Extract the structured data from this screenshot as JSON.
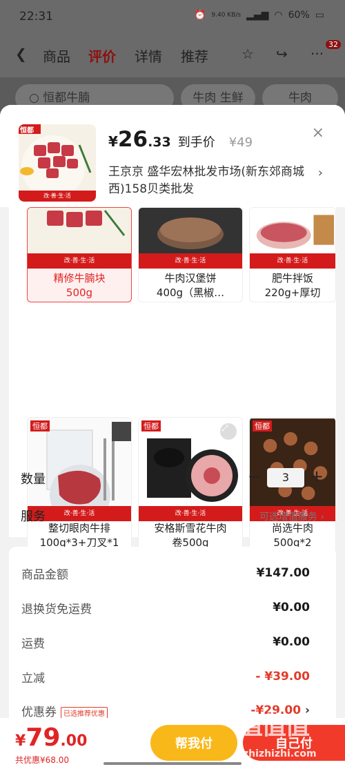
{
  "status_bar": {
    "time": "22:31",
    "speed": "9.40 KB/s",
    "battery": "60%"
  },
  "bg_nav": {
    "tabs": [
      "商品",
      "评价",
      "详情",
      "推荐"
    ],
    "active_tab": "评价",
    "badge_count": "32"
  },
  "bg_search": {
    "query": "恒都牛腩",
    "chip1": "牛肉 生鲜",
    "chip2": "牛肉"
  },
  "header": {
    "price_yen": "¥",
    "price_int": "26",
    "price_dec": ".33",
    "price_tag": "到手价",
    "original_price": "¥49",
    "shop_info": "王京京  盛华宏林批发市场(新东郊商城西)158贝类批发",
    "close_symbol": "×",
    "brand": "恒都",
    "band_text": "改·善·生·活"
  },
  "variants": [
    {
      "label": "精修牛腩块\n500g",
      "line1": "精修牛腩块",
      "line2": "500g",
      "selected": true
    },
    {
      "label": "牛肉汉堡饼",
      "line1": "牛肉汉堡饼",
      "line2": "400g（黑椒…",
      "selected": false
    },
    {
      "label": "肥牛拌饭",
      "line1": "肥牛拌饭",
      "line2": "220g+厚切",
      "selected": false
    },
    {
      "label": "整切眼肉牛排",
      "line1": "整切眼肉牛排",
      "line2": "100g*3+刀叉*1",
      "selected": false
    },
    {
      "label": "安格斯雪花牛肉",
      "line1": "安格斯雪花牛肉",
      "line2": "卷500g",
      "selected": false
    },
    {
      "label": "尚选牛肉",
      "line1": "尚选牛肉",
      "line2": "500g*2",
      "selected": false
    }
  ],
  "quantity": {
    "label": "数量",
    "value": "3",
    "minus": "−",
    "plus": "+"
  },
  "service": {
    "label": "服务",
    "option": "可选增值服务"
  },
  "summary": {
    "rows": [
      {
        "key": "商品金额",
        "value": "¥147.00"
      },
      {
        "key": "退换货免运费",
        "value": "¥0.00"
      },
      {
        "key": "运费",
        "value": "¥0.00"
      },
      {
        "key": "立减",
        "value": "- ¥39.00"
      },
      {
        "key": "优惠券",
        "value": "-¥29.00"
      }
    ],
    "coupon_tag": "已选推荐优惠"
  },
  "bottom_bar": {
    "price_yen": "¥",
    "price_int": "79",
    "price_dec": ".00",
    "total_discount": "共优惠¥68.00",
    "help_pay": "帮我付",
    "pay": "自己付"
  },
  "watermark": {
    "logo": "值值值",
    "domain": "zhizhizhi.com"
  },
  "colors": {
    "accent_red": "#e02424",
    "help_yellow": "#f9b81a",
    "pay_red": "#f23a2a"
  }
}
